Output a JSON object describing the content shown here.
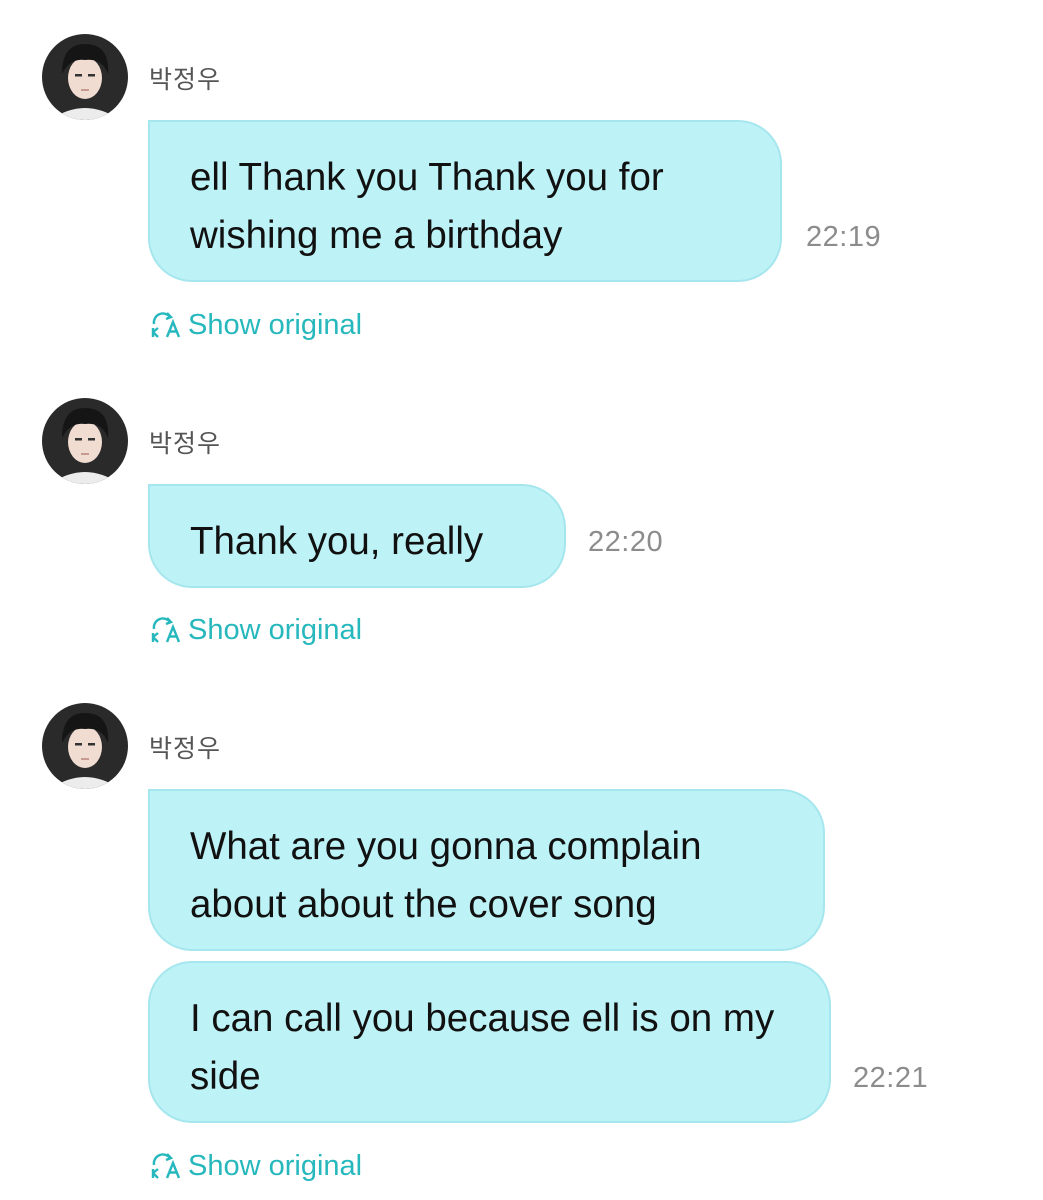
{
  "messages": [
    {
      "sender": "박정우",
      "bubbles": [
        "ell Thank you Thank you for wishing me a birthday"
      ],
      "time": "22:19",
      "show_original": "Show original"
    },
    {
      "sender": "박정우",
      "bubbles": [
        "Thank you, really"
      ],
      "time": "22:20",
      "show_original": "Show original"
    },
    {
      "sender": "박정우",
      "bubbles": [
        "What are you gonna complain about about the cover song",
        "I can call you because ell is on my side"
      ],
      "time": "22:21",
      "show_original": "Show original"
    }
  ],
  "colors": {
    "bubble": "#bdf2f6",
    "bubble_border": "#a6e6ee",
    "link": "#27b8bd",
    "time": "#8c8c8c"
  },
  "icons": {
    "translate": "translate-icon",
    "avatar": "avatar-photo"
  }
}
